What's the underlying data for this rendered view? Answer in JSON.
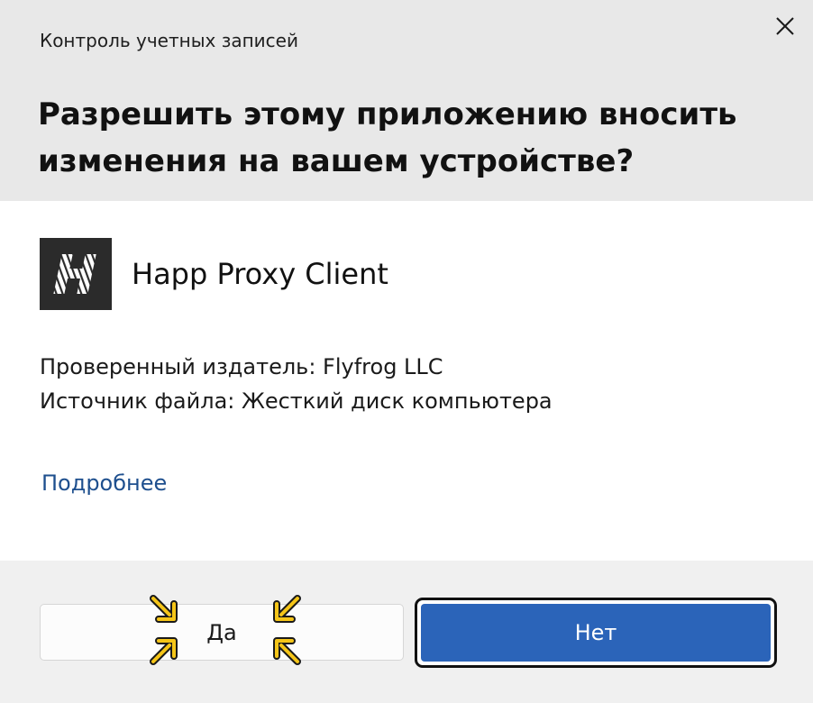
{
  "window": {
    "title": "Контроль учетных записей",
    "close_icon": "close-icon"
  },
  "prompt": {
    "question": "Разрешить этому приложению вносить изменения на вашем устройстве?"
  },
  "app": {
    "name": "Happ Proxy Client",
    "icon": "happ-logo-icon",
    "icon_bg": "#2b2b2b"
  },
  "details": {
    "publisher_line": "Проверенный издатель: Flyfrog LLC",
    "source_line": "Источник файла: Жесткий диск компьютера"
  },
  "links": {
    "more": "Подробнее"
  },
  "buttons": {
    "yes_label": "Да",
    "no_label": "Нет"
  },
  "colors": {
    "header_bg": "#e8e8e8",
    "footer_bg": "#f0f0f0",
    "primary_button": "#2b64b9",
    "link": "#1e4f8e",
    "highlight_arrows": "#f5c518"
  }
}
